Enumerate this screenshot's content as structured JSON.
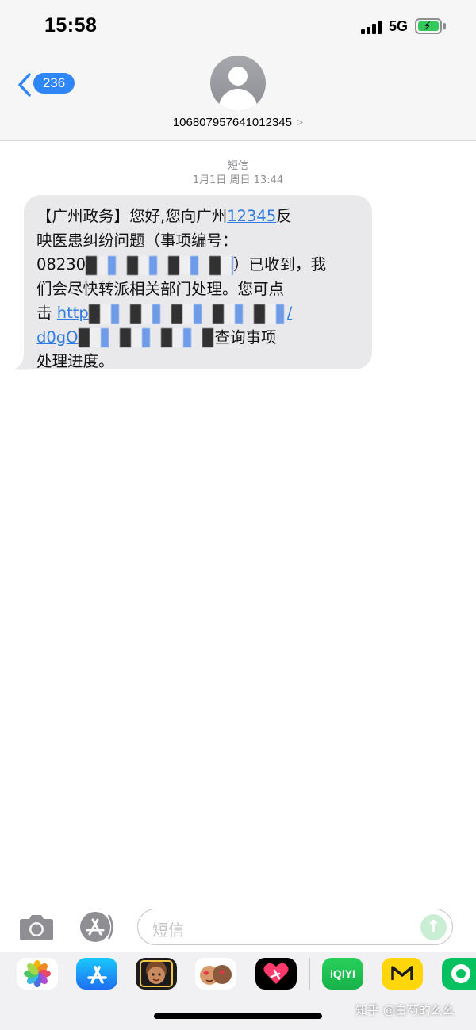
{
  "status_bar": {
    "time": "15:58",
    "network": "5G"
  },
  "header": {
    "unread_count": "236",
    "contact": "106807957641012345"
  },
  "thread": {
    "message_type": "短信",
    "timestamp": "1月1日 周日 13:44"
  },
  "message": {
    "line1_a": "【广州政务】您好,您向广州",
    "line1_link": "12345",
    "line1_b": "反",
    "line2": "映医患纠纷问题（事项编号：",
    "line3_a": "08230",
    "line3_b": "）已收到，我",
    "line4": "们会尽快转派相关部门处理。您可点",
    "line5_a": "击",
    "line5_link": "http",
    "line6_link": "d0gO",
    "line6_b": "查询事项",
    "line7": "处理进度。"
  },
  "compose": {
    "placeholder": "短信"
  },
  "drawer": {
    "apps": [
      {
        "name": "photos-icon"
      },
      {
        "name": "app-store-icon"
      },
      {
        "name": "memoji-icon"
      },
      {
        "name": "animoji-icon"
      },
      {
        "name": "digital-touch-icon"
      },
      {
        "name": "iqiyi-icon",
        "label": "iQIYI"
      },
      {
        "name": "wechat-reading-icon"
      },
      {
        "name": "app-icon"
      }
    ]
  },
  "watermark": "知乎 @白芍的幺幺",
  "colors": {
    "accent": "#2f86f6",
    "bubble": "#e9e9eb",
    "link": "#2f7de1",
    "header_bg": "#f6f6f6"
  }
}
